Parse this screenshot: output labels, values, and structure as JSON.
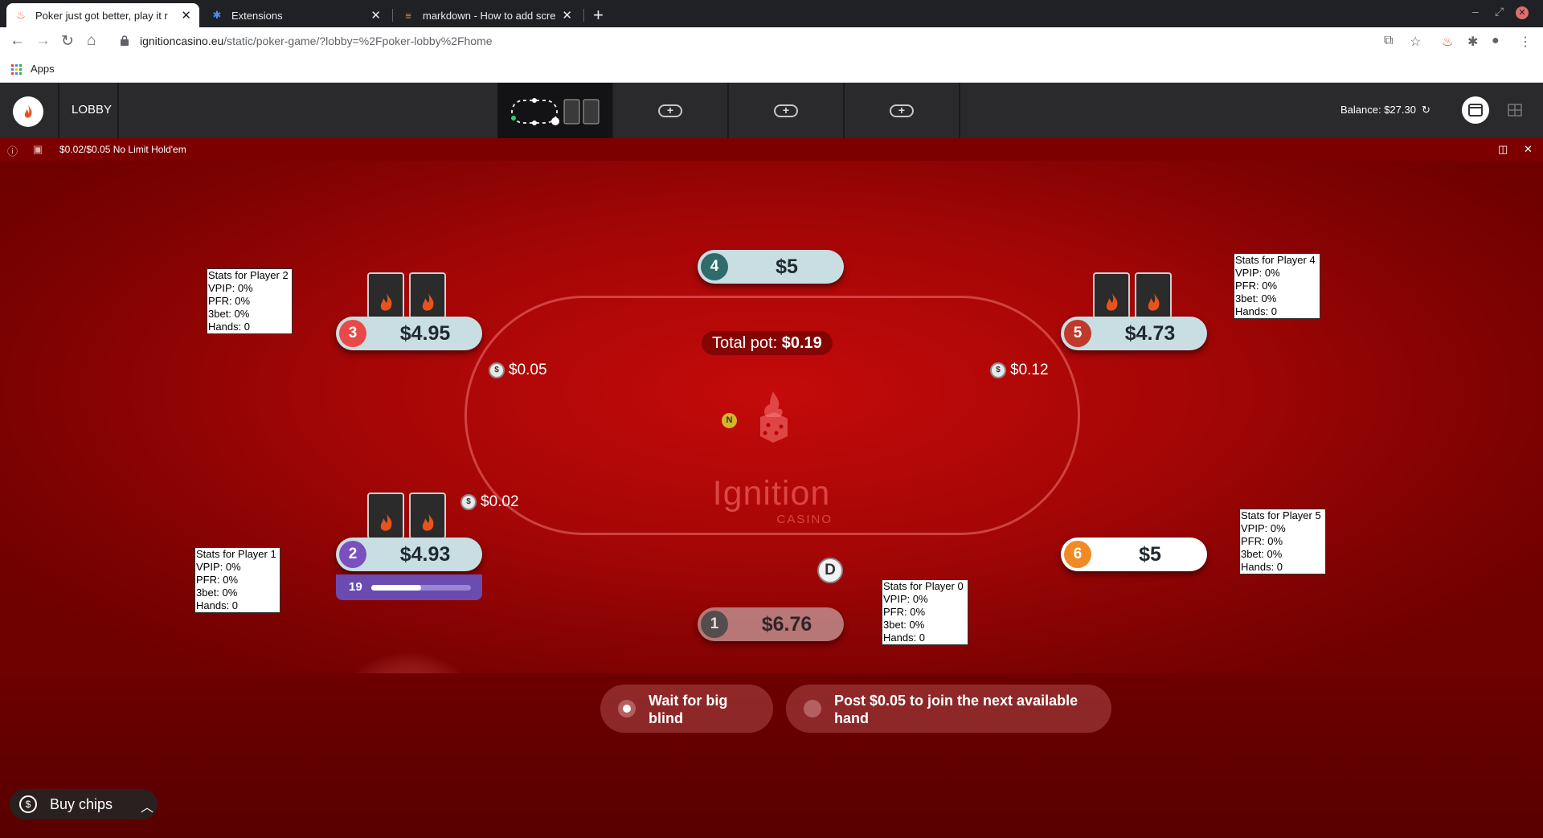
{
  "browser": {
    "tabs": [
      {
        "title": "Poker just got better, play it r",
        "icon": "ignition-favicon"
      },
      {
        "title": "Extensions",
        "icon": "puzzle-icon"
      },
      {
        "title": "markdown - How to add scre",
        "icon": "stackoverflow-favicon"
      }
    ],
    "url_host": "ignitioncasino.eu",
    "url_path": "/static/poker-game/?lobby=%2Fpoker-lobby%2Fhome",
    "bookmarks_apps": "Apps"
  },
  "app": {
    "lobby_label": "LOBBY",
    "balance": "Balance: $27.30",
    "game_title": "$0.02/$0.05 No Limit Hold'em"
  },
  "table": {
    "pot_label": "Total pot:",
    "pot_value": "$0.19",
    "brand": "Ignition",
    "brand_sub": "CASINO",
    "dealer_label": "D",
    "new_badge": "N",
    "seats": {
      "s1": {
        "num": "1",
        "stack": "$6.76",
        "color": "#4a5a5a"
      },
      "s2": {
        "num": "2",
        "stack": "$4.93",
        "color": "#7a4fc0"
      },
      "s3": {
        "num": "3",
        "stack": "$4.95",
        "color": "#e84a4a"
      },
      "s4": {
        "num": "4",
        "stack": "$5",
        "color": "#2f6b6b"
      },
      "s5": {
        "num": "5",
        "stack": "$4.73",
        "color": "#c0392b"
      },
      "s6": {
        "num": "6",
        "stack": "$5",
        "color": "#f08a24"
      }
    },
    "bets": {
      "left": "$0.05",
      "right": "$0.12",
      "seat2": "$0.02"
    },
    "timer": {
      "seconds": "19",
      "fraction": 0.5
    },
    "stats": {
      "p2": [
        "Stats for Player 2",
        "VPIP: 0%",
        "PFR: 0%",
        "3bet: 0%",
        "Hands: 0"
      ],
      "p1": [
        "Stats for Player 1",
        "VPIP: 0%",
        "PFR: 0%",
        "3bet: 0%",
        "Hands: 0"
      ],
      "p4": [
        "Stats for Player 4",
        "VPIP: 0%",
        "PFR: 0%",
        "3bet: 0%",
        "Hands: 0"
      ],
      "p5": [
        "Stats for Player 5",
        "VPIP: 0%",
        "PFR: 0%",
        "3bet: 0%",
        "Hands: 0"
      ],
      "p0": [
        "Stats for Player 0",
        "VPIP: 0%",
        "PFR: 0%",
        "3bet: 0%",
        "Hands: 0"
      ]
    }
  },
  "actions": {
    "wait_line1": "Wait for big",
    "wait_line2": "blind",
    "post_line1": "Post $0.05 to join the next available",
    "post_line2": "hand",
    "buy_chips": "Buy chips"
  }
}
